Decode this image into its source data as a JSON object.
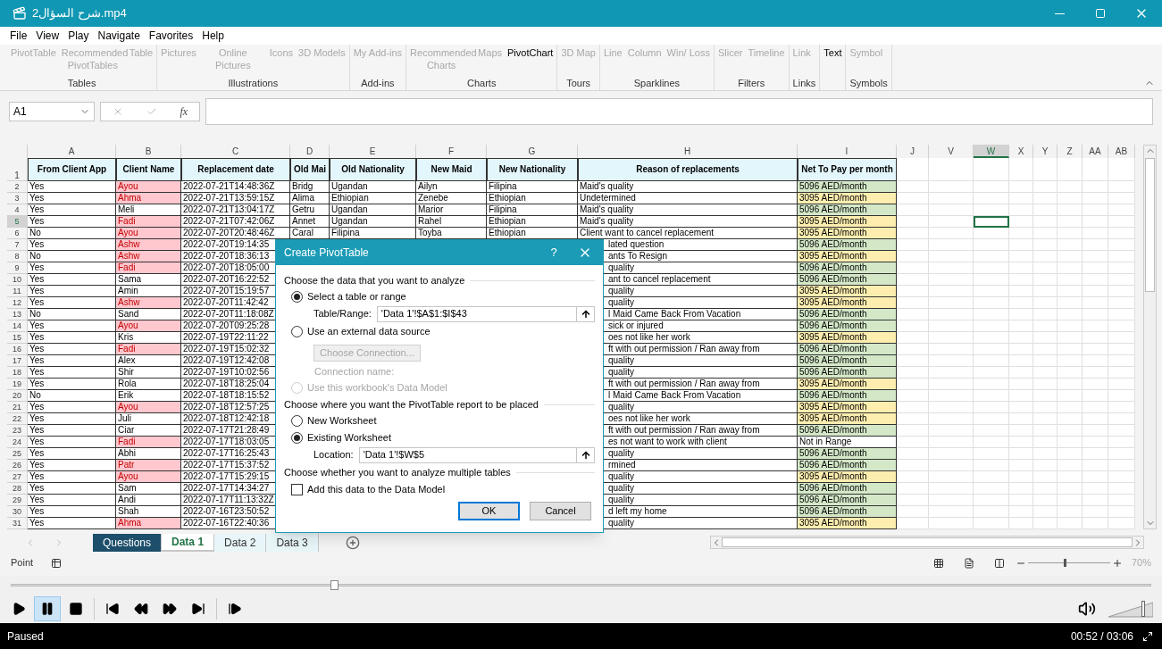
{
  "window": {
    "title": "شرح السؤال2.mp4"
  },
  "menu": [
    "File",
    "View",
    "Play",
    "Navigate",
    "Favorites",
    "Help"
  ],
  "ribbon": [
    {
      "label": "Tables",
      "items": [
        {
          "text": "PivotTable",
          "disabled": true
        },
        {
          "text": "Recommended PivotTables",
          "disabled": true
        },
        {
          "text": "Table",
          "disabled": true
        }
      ]
    },
    {
      "label": "Illustrations",
      "items": [
        {
          "text": "Pictures",
          "disabled": true
        },
        {
          "text": "Online Pictures",
          "disabled": true
        },
        {
          "text": "Icons",
          "disabled": true
        },
        {
          "text": "3D Models",
          "disabled": true
        }
      ]
    },
    {
      "label": "Add-ins",
      "items": [
        {
          "text": "My Add-ins",
          "disabled": true
        }
      ]
    },
    {
      "label": "Charts",
      "items": [
        {
          "text": "Recommended Charts",
          "disabled": true
        },
        {
          "text": "Maps",
          "disabled": true
        },
        {
          "text": "PivotChart",
          "disabled": false
        }
      ]
    },
    {
      "label": "Tours",
      "items": [
        {
          "text": "3D Map",
          "disabled": true
        }
      ]
    },
    {
      "label": "Sparklines",
      "items": [
        {
          "text": "Line",
          "disabled": true
        },
        {
          "text": "Column",
          "disabled": true
        },
        {
          "text": "Win/ Loss",
          "disabled": true
        }
      ]
    },
    {
      "label": "Filters",
      "items": [
        {
          "text": "Slicer",
          "disabled": true
        },
        {
          "text": "Timeline",
          "disabled": true
        }
      ]
    },
    {
      "label": "Links",
      "items": [
        {
          "text": "Link",
          "disabled": true
        }
      ]
    },
    {
      "items": [
        {
          "text": "Text",
          "disabled": false
        }
      ]
    },
    {
      "label": "Symbols",
      "items": [
        {
          "text": "Symbol",
          "disabled": true
        }
      ]
    }
  ],
  "formula_bar": {
    "name_box": "A1",
    "function_label": "fx"
  },
  "sheet": {
    "columns": [
      {
        "letter": "A",
        "selected": false
      },
      {
        "letter": "B",
        "selected": false
      },
      {
        "letter": "C",
        "selected": false
      },
      {
        "letter": "D",
        "selected": false
      },
      {
        "letter": "E",
        "selected": false
      },
      {
        "letter": "F",
        "selected": false
      },
      {
        "letter": "G",
        "selected": false
      },
      {
        "letter": "H",
        "selected": false
      },
      {
        "letter": "I",
        "selected": false
      },
      {
        "letter": "J",
        "selected": false
      },
      {
        "letter": "V",
        "selected": false
      },
      {
        "letter": "W",
        "selected": true
      },
      {
        "letter": "X",
        "selected": false
      },
      {
        "letter": "Y",
        "selected": false
      },
      {
        "letter": "Z",
        "selected": false
      },
      {
        "letter": "AA",
        "selected": false
      },
      {
        "letter": "AB",
        "selected": false
      }
    ],
    "header_row": {
      "number": "1",
      "cells": [
        "From Client App",
        "Client Name",
        "Replacement date",
        "Old Mai",
        "Old Nationality",
        "New Maid",
        "New Nationality",
        "Reason of replacements",
        "Net To Pay per month"
      ]
    },
    "rows": [
      {
        "number": "2",
        "selected": false,
        "from_client_app": "Yes",
        "client_name": {
          "text": "Ayou",
          "highlight": true
        },
        "replacement_date": "2022-07-21T14:48:36Z",
        "old_maid": "Bridg",
        "old_nationality": "Ugandan",
        "new_maid": "Ailyn",
        "new_nationality": "Filipina",
        "reason": "Maid's quality",
        "net_to_pay": {
          "text": "5096 AED/month",
          "color": "#d4e8c8"
        }
      },
      {
        "number": "3",
        "selected": false,
        "from_client_app": "Yes",
        "client_name": {
          "text": "Ahma",
          "highlight": true
        },
        "replacement_date": "2022-07-21T13:59:15Z",
        "old_maid": "Alima",
        "old_nationality": "Ethiopian",
        "new_maid": "Zenebe",
        "new_nationality": "Ethiopian",
        "reason": "Undetermined",
        "net_to_pay": {
          "text": "3095 AED/month",
          "color": "#fdeeb0"
        }
      },
      {
        "number": "4",
        "selected": false,
        "from_client_app": "Yes",
        "client_name": {
          "text": "Meli",
          "highlight": false
        },
        "replacement_date": "2022-07-21T13:04:17Z",
        "old_maid": "Getru",
        "old_nationality": "Ugandan",
        "new_maid": "Marior",
        "new_nationality": "Filipina",
        "reason": "Maid's quality",
        "net_to_pay": {
          "text": "5096 AED/month",
          "color": "#d4e8c8"
        }
      },
      {
        "number": "5",
        "selected": true,
        "from_client_app": "Yes",
        "client_name": {
          "text": "Fadi",
          "highlight": true
        },
        "replacement_date": "2022-07-21T07:42:06Z",
        "old_maid": "Annet",
        "old_nationality": "Ugandan",
        "new_maid": "Rahel",
        "new_nationality": "Ethiopian",
        "reason": "Maid's quality",
        "net_to_pay": {
          "text": "3095 AED/month",
          "color": "#fdeeb0"
        }
      },
      {
        "number": "6",
        "selected": false,
        "from_client_app": "No",
        "client_name": {
          "text": "Ayou",
          "highlight": true
        },
        "replacement_date": "2022-07-20T20:48:46Z",
        "old_maid": "Caral",
        "old_nationality": "Filipina",
        "new_maid": "Toyba",
        "new_nationality": "Ethiopian",
        "reason": "Client want to cancel replacement",
        "net_to_pay": {
          "text": "3095 AED/month",
          "color": "#fdeeb0"
        }
      },
      {
        "number": "7",
        "selected": false,
        "from_client_app": "Yes",
        "client_name": {
          "text": "Ashw",
          "highlight": true
        },
        "replacement_date": "2022-07-20T19:14:35",
        "reason": "lated question",
        "net_to_pay": {
          "text": "5096 AED/month",
          "color": "#d4e8c8"
        }
      },
      {
        "number": "8",
        "selected": false,
        "from_client_app": "No",
        "client_name": {
          "text": "Ashw",
          "highlight": true
        },
        "replacement_date": "2022-07-20T18:36:13",
        "reason": "ants To Resign",
        "net_to_pay": {
          "text": "3095 AED/month",
          "color": "#fdeeb0"
        }
      },
      {
        "number": "9",
        "selected": false,
        "from_client_app": "Yes",
        "client_name": {
          "text": "Fadi",
          "highlight": true
        },
        "replacement_date": "2022-07-20T18:05:00",
        "reason": "quality",
        "net_to_pay": {
          "text": "5096 AED/month",
          "color": "#d4e8c8"
        }
      },
      {
        "number": "10",
        "selected": false,
        "from_client_app": "Yes",
        "client_name": {
          "text": "Sama",
          "highlight": false
        },
        "replacement_date": "2022-07-20T16:22:52",
        "reason": "ant to cancel replacement",
        "net_to_pay": {
          "text": "5096 AED/month",
          "color": "#d4e8c8"
        }
      },
      {
        "number": "11",
        "selected": false,
        "from_client_app": "Yes",
        "client_name": {
          "text": "Amin",
          "highlight": false
        },
        "replacement_date": "2022-07-20T15:19:57",
        "reason": "quality",
        "net_to_pay": {
          "text": "3095 AED/month",
          "color": "#fdeeb0"
        }
      },
      {
        "number": "12",
        "selected": false,
        "from_client_app": "Yes",
        "client_name": {
          "text": "Ashw",
          "highlight": true
        },
        "replacement_date": "2022-07-20T11:42:42",
        "reason": "quality",
        "net_to_pay": {
          "text": "3095 AED/month",
          "color": "#fdeeb0"
        }
      },
      {
        "number": "13",
        "selected": false,
        "from_client_app": "No",
        "client_name": {
          "text": "Sand",
          "highlight": false
        },
        "replacement_date": "2022-07-20T11:18:08Z",
        "reason": "l Maid Came Back From Vacation",
        "net_to_pay": {
          "text": "5096 AED/month",
          "color": "#d4e8c8"
        }
      },
      {
        "number": "14",
        "selected": false,
        "from_client_app": "Yes",
        "client_name": {
          "text": "Ayou",
          "highlight": true
        },
        "replacement_date": "2022-07-20T09:25:28",
        "reason": "sick or injured",
        "net_to_pay": {
          "text": "5096 AED/month",
          "color": "#d4e8c8"
        }
      },
      {
        "number": "15",
        "selected": false,
        "from_client_app": "Yes",
        "client_name": {
          "text": "Kris",
          "highlight": false
        },
        "replacement_date": "2022-07-19T22:11:22",
        "reason": "oes not like her work",
        "net_to_pay": {
          "text": "3095 AED/month",
          "color": "#fdeeb0"
        }
      },
      {
        "number": "16",
        "selected": false,
        "from_client_app": "Yes",
        "client_name": {
          "text": "Fadi",
          "highlight": true
        },
        "replacement_date": "2022-07-19T15:02:32",
        "reason": "ft with out permission / Ran away from",
        "net_to_pay": {
          "text": "5096 AED/month",
          "color": "#d4e8c8"
        }
      },
      {
        "number": "17",
        "selected": false,
        "from_client_app": "Yes",
        "client_name": {
          "text": "Alex",
          "highlight": false
        },
        "replacement_date": "2022-07-19T12:42:08",
        "reason": "quality",
        "net_to_pay": {
          "text": "5096 AED/month",
          "color": "#d4e8c8"
        }
      },
      {
        "number": "18",
        "selected": false,
        "from_client_app": "Yes",
        "client_name": {
          "text": "Shir",
          "highlight": false
        },
        "replacement_date": "2022-07-19T10:02:56",
        "reason": "quality",
        "net_to_pay": {
          "text": "5096 AED/month",
          "color": "#d4e8c8"
        }
      },
      {
        "number": "19",
        "selected": false,
        "from_client_app": "Yes",
        "client_name": {
          "text": "Rola",
          "highlight": false
        },
        "replacement_date": "2022-07-18T18:25:04",
        "reason": "ft with out permission / Ran away from",
        "net_to_pay": {
          "text": "3095 AED/month",
          "color": "#fdeeb0"
        }
      },
      {
        "number": "20",
        "selected": false,
        "from_client_app": "No",
        "client_name": {
          "text": "Erik",
          "highlight": false
        },
        "replacement_date": "2022-07-18T18:15:52",
        "reason": "l Maid Came Back From Vacation",
        "net_to_pay": {
          "text": "5096 AED/month",
          "color": "#d4e8c8"
        }
      },
      {
        "number": "21",
        "selected": false,
        "from_client_app": "Yes",
        "client_name": {
          "text": "Ayou",
          "highlight": true
        },
        "replacement_date": "2022-07-18T12:57:25",
        "reason": "quality",
        "net_to_pay": {
          "text": "3095 AED/month",
          "color": "#fdeeb0"
        }
      },
      {
        "number": "22",
        "selected": false,
        "from_client_app": "Yes",
        "client_name": {
          "text": "Juli",
          "highlight": false
        },
        "replacement_date": "2022-07-18T12:42:18",
        "reason": "oes not like her work",
        "net_to_pay": {
          "text": "3095 AED/month",
          "color": "#fdeeb0"
        }
      },
      {
        "number": "23",
        "selected": false,
        "from_client_app": "Yes",
        "client_name": {
          "text": "Ciar",
          "highlight": false
        },
        "replacement_date": "2022-07-17T21:28:49",
        "reason": "ft with out permission / Ran away from",
        "net_to_pay": {
          "text": "5096 AED/month",
          "color": "#d4e8c8"
        }
      },
      {
        "number": "24",
        "selected": false,
        "from_client_app": "Yes",
        "client_name": {
          "text": "Fadi",
          "highlight": true
        },
        "replacement_date": "2022-07-17T18:03:05",
        "reason": "es not want to work with client",
        "net_to_pay": {
          "text": "Not in Range",
          "color": "#ffffff"
        }
      },
      {
        "number": "25",
        "selected": false,
        "from_client_app": "Yes",
        "client_name": {
          "text": "Abhi",
          "highlight": false
        },
        "replacement_date": "2022-07-17T16:25:43",
        "reason": "quality",
        "net_to_pay": {
          "text": "5096 AED/month",
          "color": "#d4e8c8"
        }
      },
      {
        "number": "26",
        "selected": false,
        "from_client_app": "Yes",
        "client_name": {
          "text": "Patr",
          "highlight": true
        },
        "replacement_date": "2022-07-17T15:37:52",
        "reason": "rmined",
        "net_to_pay": {
          "text": "5096 AED/month",
          "color": "#d4e8c8"
        }
      },
      {
        "number": "27",
        "selected": false,
        "from_client_app": "Yes",
        "client_name": {
          "text": "Ayou",
          "highlight": true
        },
        "replacement_date": "2022-07-17T15:29:15",
        "reason": "quality",
        "net_to_pay": {
          "text": "3095 AED/month",
          "color": "#fdeeb0"
        }
      },
      {
        "number": "28",
        "selected": false,
        "from_client_app": "Yes",
        "client_name": {
          "text": "Sam",
          "highlight": false
        },
        "replacement_date": "2022-07-17T14:34:27",
        "reason": "quality",
        "net_to_pay": {
          "text": "5096 AED/month",
          "color": "#d4e8c8"
        }
      },
      {
        "number": "29",
        "selected": false,
        "from_client_app": "Yes",
        "client_name": {
          "text": "Andi",
          "highlight": false
        },
        "replacement_date": "2022-07-17T11:13:32Z",
        "reason": "quality",
        "net_to_pay": {
          "text": "5096 AED/month",
          "color": "#d4e8c8"
        }
      },
      {
        "number": "30",
        "selected": false,
        "from_client_app": "Yes",
        "client_name": {
          "text": "Shah",
          "highlight": false
        },
        "replacement_date": "2022-07-16T23:50:52",
        "reason": "d left my home",
        "net_to_pay": {
          "text": "5096 AED/month",
          "color": "#d4e8c8"
        }
      },
      {
        "number": "31",
        "selected": false,
        "from_client_app": "Yes",
        "client_name": {
          "text": "Ahma",
          "highlight": true
        },
        "replacement_date": "2022-07-16T22:40:36",
        "reason": "quality",
        "net_to_pay": {
          "text": "3095 AED/month",
          "color": "#fdeeb0"
        }
      }
    ]
  },
  "sheet_tabs": [
    {
      "label": "Questions",
      "selected": false,
      "kind": "dark"
    },
    {
      "label": "Data 1",
      "selected": true,
      "kind": "plain"
    },
    {
      "label": "Data 2",
      "selected": false,
      "kind": "plain"
    },
    {
      "label": "Data 3",
      "selected": false,
      "kind": "plain"
    }
  ],
  "excel_status": {
    "mode": "Point",
    "zoom": "70%",
    "zoom_slider": {
      "level": 0.45
    }
  },
  "dialog": {
    "title": "Create PivotTable",
    "help": "?",
    "sections": [
      {
        "heading": "Choose the data that you want to analyze",
        "items": [
          {
            "kind": "radio",
            "label": "Select a table or range",
            "selected": true,
            "disabled": false
          },
          {
            "kind": "field",
            "label": "Table/Range:",
            "value": "'Data 1'!$A$1:$I$43"
          },
          {
            "kind": "radio",
            "label": "Use an external data source",
            "selected": false,
            "disabled": false
          },
          {
            "kind": "button",
            "label": "Choose Connection...",
            "disabled": true
          },
          {
            "kind": "note",
            "label": "Connection name:",
            "disabled": true
          },
          {
            "kind": "radio",
            "label": "Use this workbook's Data Model",
            "selected": false,
            "disabled": true
          }
        ]
      },
      {
        "heading": "Choose where you want the PivotTable report to be placed",
        "items": [
          {
            "kind": "radio",
            "label": "New Worksheet",
            "selected": false,
            "disabled": false
          },
          {
            "kind": "radio",
            "label": "Existing Worksheet",
            "selected": true,
            "disabled": false
          },
          {
            "kind": "field",
            "label": "Location:",
            "value": "'Data 1'!$W$5"
          }
        ]
      },
      {
        "heading": "Choose whether you want to analyze multiple tables",
        "items": [
          {
            "kind": "checkbox",
            "label": "Add this data to the Data Model",
            "checked": false
          }
        ]
      }
    ],
    "buttons": [
      {
        "label": "OK",
        "default": true
      },
      {
        "label": "Cancel",
        "default": false
      }
    ]
  },
  "player": {
    "seek": {
      "level": 0.28
    },
    "controls": [
      {
        "kind": "play",
        "selected": false
      },
      {
        "kind": "pause",
        "selected": true
      },
      {
        "kind": "stop",
        "selected": false
      },
      {
        "kind": "previous",
        "selected": false
      },
      {
        "kind": "rewind",
        "selected": false
      },
      {
        "kind": "forward",
        "selected": false
      },
      {
        "kind": "next",
        "selected": false
      },
      {
        "kind": "frame_step",
        "selected": false
      }
    ],
    "volume": {
      "level": 0.85
    },
    "status": "Paused",
    "time": "00:52 / 03:06"
  }
}
